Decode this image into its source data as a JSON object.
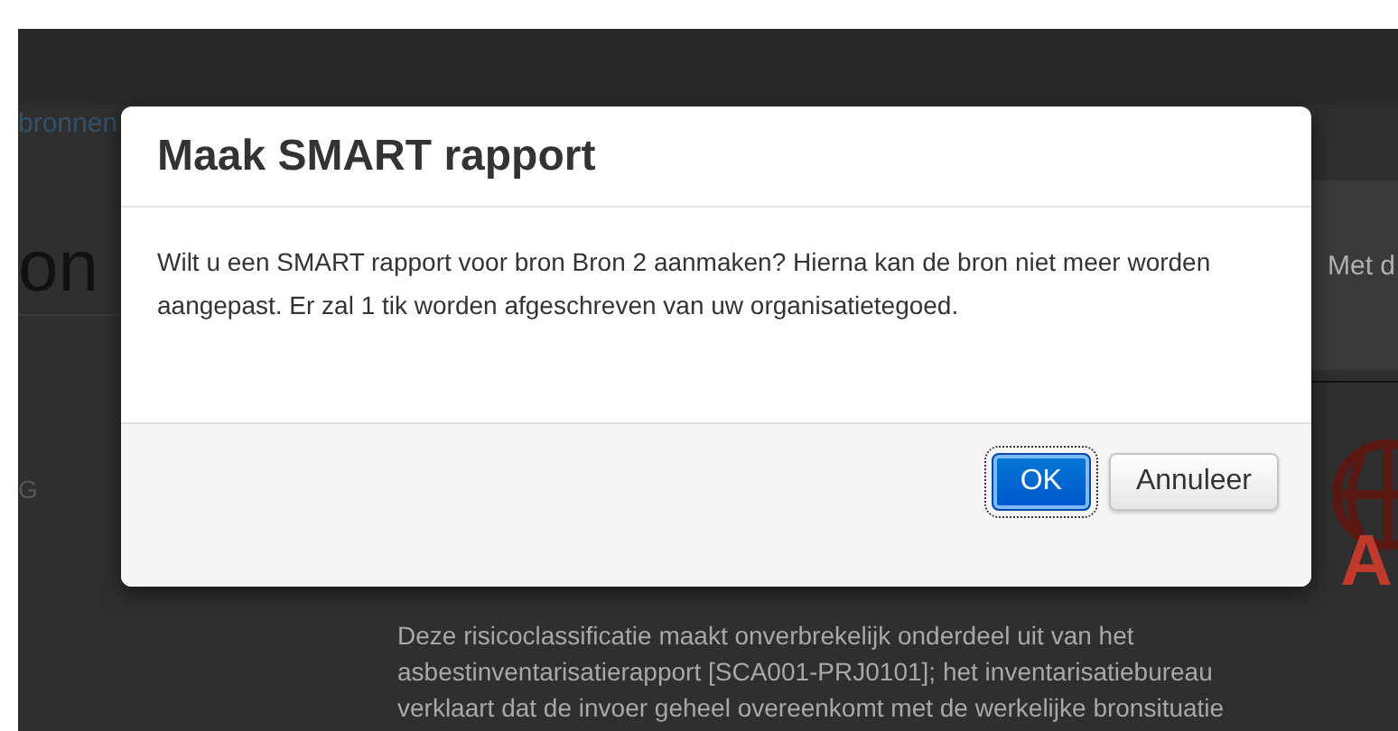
{
  "page": {
    "breadcrumb": "bronnen",
    "heading": "on",
    "label": "G",
    "side_text": "Met d",
    "logo_text": "A",
    "paragraph": "Deze risicoclassificatie maakt onverbrekelijk onderdeel uit van het asbestinventarisatierapport [SCA001-PRJ0101]; het inventarisatiebureau verklaart dat de invoer geheel overeenkomt met de werkelijke bronsituatie"
  },
  "dialog": {
    "title": "Maak SMART rapport",
    "message": "Wilt u een SMART rapport voor bron Bron 2 aanmaken? Hierna kan de bron niet meer worden aangepast. Er zal 1 tik worden afgeschreven van uw organisatietegoed.",
    "buttons": [
      {
        "label": "OK",
        "kind": "primary",
        "focused": true
      },
      {
        "label": "Annuleer",
        "kind": "default",
        "focused": false
      }
    ]
  }
}
